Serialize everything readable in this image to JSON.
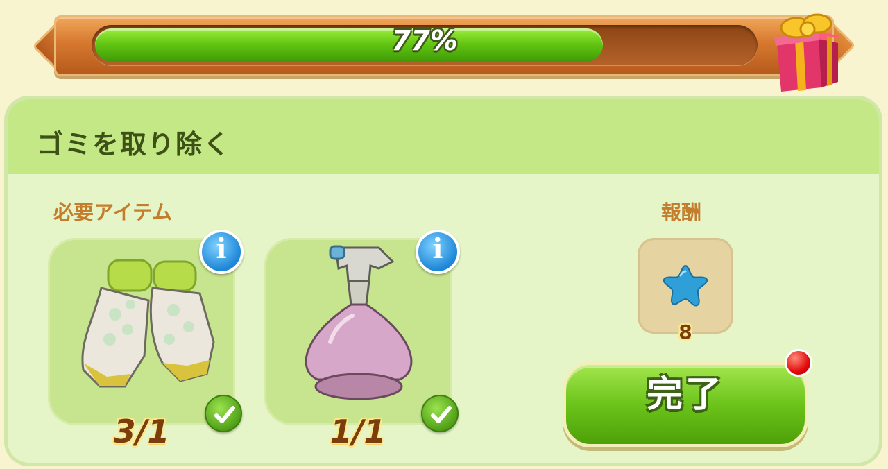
{
  "progress": {
    "percent_label": "77%",
    "fraction": 0.77,
    "reward_icon": "gift-box-icon"
  },
  "task": {
    "title": "ゴミを取り除く",
    "required_label": "必要アイテム",
    "reward_label": "報酬",
    "items": [
      {
        "name": "gardening-gloves",
        "count": "3/1",
        "info": "i",
        "completed": true
      },
      {
        "name": "spray-bottle",
        "count": "1/1",
        "info": "i",
        "completed": true
      }
    ],
    "reward": {
      "icon": "blue-star-icon",
      "amount": "8"
    },
    "complete_button": "完了"
  },
  "colors": {
    "progress_fill": "#64c713",
    "panel_bg": "#e6f5c7",
    "header_bg": "#c4e885",
    "label_orange": "#c47c2d",
    "info_blue": "#1e86d6"
  }
}
